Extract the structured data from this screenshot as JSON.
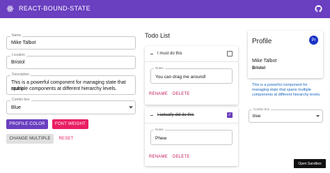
{
  "app": {
    "title": "REACT-BOUND-STATE"
  },
  "form": {
    "name": {
      "label": "Name",
      "value": "Mike Talbot"
    },
    "location": {
      "label": "Location",
      "value": "Bristol"
    },
    "description": {
      "label": "Description",
      "value_line1": "This is a powerful component for managing state that spans",
      "value_line2": "multiple components at different hierarchy levels."
    },
    "combo": {
      "label": "Combo box",
      "value": "Blue"
    }
  },
  "buttons": {
    "profile_color": "PROFILE COLOR",
    "font_weight": "FONT WEIGHT",
    "change_multiple": "CHANGE MULTIPLE",
    "reset": "RESET"
  },
  "todo": {
    "title": "Todo List",
    "items": [
      {
        "text": "I must do this",
        "done": false,
        "notes_label": "Notes",
        "notes_value": "You can drag me around!",
        "rename": "RENAME",
        "delete": "DELETE"
      },
      {
        "text": "I actually did do this",
        "done": true,
        "notes_label": "Notes",
        "notes_value": "Phew",
        "rename": "RENAME",
        "delete": "DELETE"
      }
    ]
  },
  "profile": {
    "title": "Profile",
    "avatar": "Pr",
    "name": "Mike Talbot",
    "location": "Bristol",
    "description": "This is a powerful component for managing state that spans multiple components at different hierarchy levels.",
    "combo_label": "Combo box",
    "combo_value": "blue"
  },
  "sandbox_label": "Open Sandbox",
  "colors": {
    "appbar": "#6a3fc0",
    "accent_pink": "#e91e63",
    "link_blue": "#1565c0",
    "avatar_blue": "#1a33c6"
  },
  "icons": {
    "logo": "react-logo-icon",
    "github": "github-icon",
    "dropdown": "dropdown-arrow-icon"
  }
}
